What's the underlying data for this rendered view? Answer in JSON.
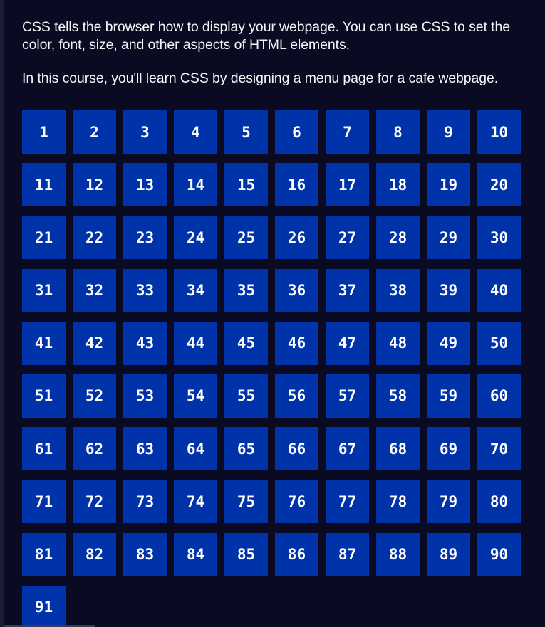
{
  "lesson": {
    "paragraph_1": "CSS tells the browser how to display your webpage. You can use CSS to set the color, font, size, and other aspects of HTML elements.",
    "paragraph_2": "In this course, you'll learn CSS by designing a menu page for a cafe webpage."
  },
  "grid": {
    "cell_color": "#0033aa",
    "text_color": "#ffffff",
    "background_color": "#0a0a23",
    "cells": [
      "1",
      "2",
      "3",
      "4",
      "5",
      "6",
      "7",
      "8",
      "9",
      "10",
      "11",
      "12",
      "13",
      "14",
      "15",
      "16",
      "17",
      "18",
      "19",
      "20",
      "21",
      "22",
      "23",
      "24",
      "25",
      "26",
      "27",
      "28",
      "29",
      "30",
      "31",
      "32",
      "33",
      "34",
      "35",
      "36",
      "37",
      "38",
      "39",
      "40",
      "41",
      "42",
      "43",
      "44",
      "45",
      "46",
      "47",
      "48",
      "49",
      "50",
      "51",
      "52",
      "53",
      "54",
      "55",
      "56",
      "57",
      "58",
      "59",
      "60",
      "61",
      "62",
      "63",
      "64",
      "65",
      "66",
      "67",
      "68",
      "69",
      "70",
      "71",
      "72",
      "73",
      "74",
      "75",
      "76",
      "77",
      "78",
      "79",
      "80",
      "81",
      "82",
      "83",
      "84",
      "85",
      "86",
      "87",
      "88",
      "89",
      "90",
      "91"
    ]
  }
}
